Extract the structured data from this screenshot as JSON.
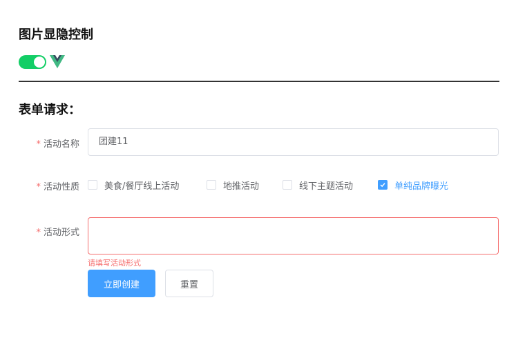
{
  "visibility_section": {
    "title": "图片显隐控制",
    "switch_on": true,
    "switch_color": "#13ce66"
  },
  "form_section": {
    "title": "表单请求："
  },
  "form": {
    "required_mark": "*",
    "activity_name": {
      "label": "活动名称",
      "value": "团建11"
    },
    "activity_nature": {
      "label": "活动性质",
      "options": [
        {
          "label": "美食/餐厅线上活动",
          "checked": false
        },
        {
          "label": "地推活动",
          "checked": false
        },
        {
          "label": "线下主题活动",
          "checked": false
        },
        {
          "label": "单纯品牌曝光",
          "checked": true
        }
      ]
    },
    "activity_form": {
      "label": "活动形式",
      "value": "",
      "error": "请填写活动形式"
    },
    "submit_label": "立即创建",
    "reset_label": "重置"
  },
  "colors": {
    "primary": "#409eff",
    "error": "#f56c6c",
    "success": "#13ce66"
  }
}
